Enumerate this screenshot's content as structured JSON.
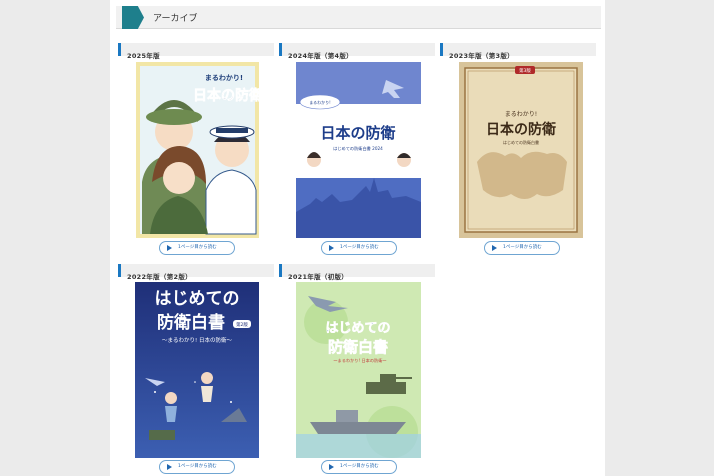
{
  "archive": {
    "title": "アーカイブ"
  },
  "read_label": "1ページ目から読む",
  "editions": [
    {
      "heading": "2025年版",
      "cover": {
        "tagline": "まるわかり!",
        "title": "日本の防衛"
      }
    },
    {
      "heading": "2024年版（第4版）",
      "cover": {
        "tagline": "まるわかり!",
        "title": "日本の防衛",
        "subtitle": "はじめての防衛白書 2024"
      }
    },
    {
      "heading": "2023年版（第3版）",
      "cover": {
        "badge": "第3版",
        "tagline": "まるわかり!",
        "title": "日本の防衛",
        "subtitle": "はじめての防衛白書"
      }
    },
    {
      "heading": "2022年版（第2版）",
      "cover": {
        "title_line1": "はじめての",
        "title_line2": "防衛白書",
        "badge": "第2版",
        "subtitle": "〜まるわかり! 日本の防衛〜"
      }
    },
    {
      "heading": "2021年版（初版）",
      "cover": {
        "title_line1": "はじめての",
        "title_line2": "防衛白書",
        "subtitle": "〜まるわかり! 日本の防衛〜"
      }
    }
  ]
}
